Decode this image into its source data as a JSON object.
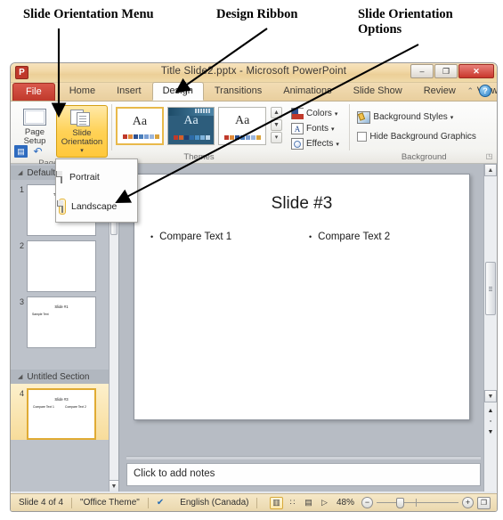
{
  "annotations": [
    {
      "id": "slide-orientation-menu",
      "text": "Slide Orientation Menu"
    },
    {
      "id": "design-ribbon",
      "text": "Design Ribbon"
    },
    {
      "id": "slide-orientation-options",
      "text": "Slide Orientation\nOptions"
    }
  ],
  "window": {
    "title": "Title Slide2.pptx  -  Microsoft PowerPoint",
    "app_icon_letter": "P",
    "buttons": {
      "minimize": "–",
      "restore": "❐",
      "close": "✕"
    }
  },
  "tabs": {
    "file": "File",
    "items": [
      {
        "label": "Home",
        "active": false
      },
      {
        "label": "Insert",
        "active": false
      },
      {
        "label": "Design",
        "active": true
      },
      {
        "label": "Transitions",
        "active": false
      },
      {
        "label": "Animations",
        "active": false
      },
      {
        "label": "Slide Show",
        "active": false
      },
      {
        "label": "Review",
        "active": false
      },
      {
        "label": "View",
        "active": false
      }
    ],
    "collapse_icon": "⌃",
    "help_icon": "?"
  },
  "quick_access": {
    "save_icon": "▤",
    "undo_icon": "↶"
  },
  "ribbon": {
    "groups": [
      {
        "name": "page-setup",
        "label": "Page Setup"
      },
      {
        "name": "themes",
        "label": "Themes"
      },
      {
        "name": "background",
        "label": "Background"
      }
    ],
    "page_setup": {
      "page_setup_label": "Page\nSetup",
      "slide_orientation_label": "Slide\nOrientation",
      "caret": "▾"
    },
    "themes": {
      "thumb_letters": "Aa",
      "scroll_up": "▲",
      "scroll_down": "▼",
      "more": "▾",
      "swatch_colors": [
        "#c0392b",
        "#e08b3a",
        "#2d4f8e",
        "#4a7ebb",
        "#7a9fd4",
        "#9bb6dd",
        "#d9a23c"
      ],
      "dark_swatch_colors": [
        "#c0392b",
        "#d45f2a",
        "#1f3f73",
        "#2d6ba8",
        "#4a90c8",
        "#7fb3dd",
        "#b8d4ea"
      ]
    },
    "background": {
      "colors_label": "Colors",
      "fonts_label": "Fonts",
      "effects_label": "Effects",
      "background_styles_label": "Background Styles",
      "hide_background_graphics_label": "Hide Background Graphics",
      "caret": "▾",
      "dialog_launcher": "◳",
      "fonts_glyph": "A"
    }
  },
  "dropdown": {
    "items": [
      {
        "label": "Portrait",
        "selected": false
      },
      {
        "label": "Landscape",
        "selected": true
      }
    ]
  },
  "slide_pane": {
    "sections": [
      {
        "label": "Default Section",
        "collapse_icon": "◢"
      },
      {
        "label": "Untitled Section",
        "collapse_icon": "◢"
      }
    ],
    "slides": [
      {
        "number": "1",
        "title": "Title Slide",
        "bullets": [],
        "selected": false,
        "section": 0
      },
      {
        "number": "2",
        "title": "",
        "bullets": [],
        "selected": false,
        "section": 0
      },
      {
        "number": "3",
        "title": "Slide #1",
        "bullets": [
          "Sample Text"
        ],
        "selected": false,
        "section": 0
      },
      {
        "number": "4",
        "title": "Slide #3",
        "bullets": [
          "Compare Text 1",
          "Compare Text 2"
        ],
        "selected": true,
        "section": 1
      }
    ],
    "scroll_down_icon": "▼"
  },
  "slide": {
    "title": "Slide #3",
    "bullet_char": "•",
    "left_text": "Compare Text 1",
    "right_text": "Compare Text 2"
  },
  "notes": {
    "placeholder": "Click to add notes"
  },
  "scrollbar": {
    "up": "▲",
    "down": "▼",
    "prev_slide": "▲",
    "next_slide": "▼",
    "dot": "▫"
  },
  "statusbar": {
    "slide_counter": "Slide 4 of 4",
    "theme": "\"Office Theme\"",
    "spellcheck_icon": "✔",
    "language": "English (Canada)",
    "views": [
      {
        "name": "normal",
        "icon": "▥",
        "active": true
      },
      {
        "name": "slide-sorter",
        "icon": "∷",
        "active": false
      },
      {
        "name": "reading-view",
        "icon": "▤",
        "active": false
      },
      {
        "name": "slide-show",
        "icon": "▷",
        "active": false
      }
    ],
    "zoom_level": "48%",
    "zoom_out_icon": "−",
    "zoom_in_icon": "+",
    "fit_icon": "❐"
  }
}
